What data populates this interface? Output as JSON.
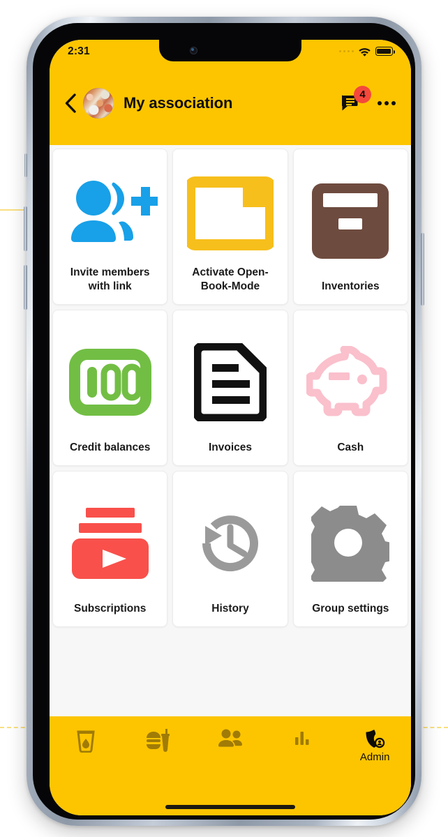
{
  "status_bar": {
    "time": "2:31",
    "cellular_icon": "signal-dots-icon",
    "wifi_icon": "wifi-icon",
    "battery_icon": "battery-full-icon"
  },
  "app_bar": {
    "back_icon": "chevron-left-icon",
    "avatar": "group-avatar-photo",
    "title": "My association",
    "chat_icon": "chat-bubble-icon",
    "chat_badge_count": "4",
    "more_icon": "more-horizontal-icon"
  },
  "colors": {
    "brand_yellow": "#FDC500",
    "badge_red": "#F4483C",
    "invite_blue": "#18A0E8",
    "folder_yellow": "#F7BF1C",
    "inventory_brown": "#6E4B3F",
    "credit_green": "#72BE44",
    "invoice_black": "#111111",
    "cash_pink": "#FAC0CC",
    "subscriptions_red": "#F9504B",
    "history_gray": "#9A9A9A",
    "settings_gray": "#8C8C8C",
    "page_bg": "#F7F7F7",
    "tile_bg": "#FFFFFF"
  },
  "tiles": [
    {
      "label": "Invite members with link",
      "icon": "invite-members-icon"
    },
    {
      "label": "Activate Open-Book-Mode",
      "icon": "open-book-folder-icon"
    },
    {
      "label": "Inventories",
      "icon": "inventory-box-icon"
    },
    {
      "label": "Credit balances",
      "icon": "credit-balance-icon"
    },
    {
      "label": "Invoices",
      "icon": "invoice-document-icon"
    },
    {
      "label": "Cash",
      "icon": "piggy-bank-icon"
    },
    {
      "label": "Subscriptions",
      "icon": "subscriptions-play-icon"
    },
    {
      "label": "History",
      "icon": "history-clock-icon"
    },
    {
      "label": "Group settings",
      "icon": "gear-icon"
    }
  ],
  "bottom_nav": [
    {
      "label": "",
      "icon": "drink-glass-icon",
      "active": false
    },
    {
      "label": "",
      "icon": "fast-food-icon",
      "active": false
    },
    {
      "label": "",
      "icon": "people-group-icon",
      "active": false
    },
    {
      "label": "",
      "icon": "bar-chart-icon",
      "active": false
    },
    {
      "label": "Admin",
      "icon": "admin-shield-icon",
      "active": true
    }
  ]
}
